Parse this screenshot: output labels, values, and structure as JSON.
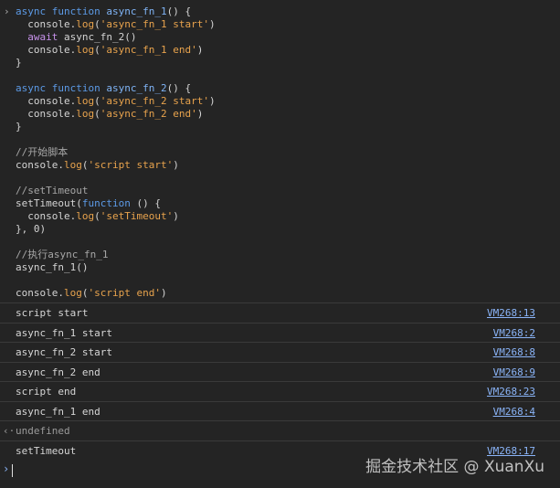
{
  "code": {
    "prompt_glyph": "›",
    "lines": [
      [
        {
          "t": "async ",
          "c": "kw-blue"
        },
        {
          "t": "function ",
          "c": "kw-blue"
        },
        {
          "t": "async_fn_1",
          "c": "fn-name"
        },
        {
          "t": "() {",
          "c": "plain"
        }
      ],
      [
        {
          "t": "  console.",
          "c": "plain"
        },
        {
          "t": "log",
          "c": "method"
        },
        {
          "t": "(",
          "c": "plain"
        },
        {
          "t": "'async_fn_1 start'",
          "c": "str"
        },
        {
          "t": ")",
          "c": "plain"
        }
      ],
      [
        {
          "t": "  await ",
          "c": "kw"
        },
        {
          "t": "async_fn_2()",
          "c": "plain"
        }
      ],
      [
        {
          "t": "  console.",
          "c": "plain"
        },
        {
          "t": "log",
          "c": "method"
        },
        {
          "t": "(",
          "c": "plain"
        },
        {
          "t": "'async_fn_1 end'",
          "c": "str"
        },
        {
          "t": ")",
          "c": "plain"
        }
      ],
      [
        {
          "t": "}",
          "c": "plain"
        }
      ],
      [],
      [
        {
          "t": "async ",
          "c": "kw-blue"
        },
        {
          "t": "function ",
          "c": "kw-blue"
        },
        {
          "t": "async_fn_2",
          "c": "fn-name"
        },
        {
          "t": "() {",
          "c": "plain"
        }
      ],
      [
        {
          "t": "  console.",
          "c": "plain"
        },
        {
          "t": "log",
          "c": "method"
        },
        {
          "t": "(",
          "c": "plain"
        },
        {
          "t": "'async_fn_2 start'",
          "c": "str"
        },
        {
          "t": ")",
          "c": "plain"
        }
      ],
      [
        {
          "t": "  console.",
          "c": "plain"
        },
        {
          "t": "log",
          "c": "method"
        },
        {
          "t": "(",
          "c": "plain"
        },
        {
          "t": "'async_fn_2 end'",
          "c": "str"
        },
        {
          "t": ")",
          "c": "plain"
        }
      ],
      [
        {
          "t": "}",
          "c": "plain"
        }
      ],
      [],
      [
        {
          "t": "//开始脚本",
          "c": "cmt"
        }
      ],
      [
        {
          "t": "console.",
          "c": "plain"
        },
        {
          "t": "log",
          "c": "method"
        },
        {
          "t": "(",
          "c": "plain"
        },
        {
          "t": "'script start'",
          "c": "str"
        },
        {
          "t": ")",
          "c": "plain"
        }
      ],
      [],
      [
        {
          "t": "//setTimeout",
          "c": "cmt"
        }
      ],
      [
        {
          "t": "setTimeout(",
          "c": "plain"
        },
        {
          "t": "function ",
          "c": "kw-blue"
        },
        {
          "t": "() {",
          "c": "plain"
        }
      ],
      [
        {
          "t": "  console.",
          "c": "plain"
        },
        {
          "t": "log",
          "c": "method"
        },
        {
          "t": "(",
          "c": "plain"
        },
        {
          "t": "'setTimeout'",
          "c": "str"
        },
        {
          "t": ")",
          "c": "plain"
        }
      ],
      [
        {
          "t": "}, 0)",
          "c": "plain"
        }
      ],
      [],
      [
        {
          "t": "//执行async_fn_1",
          "c": "cmt"
        }
      ],
      [
        {
          "t": "async_fn_1()",
          "c": "plain"
        }
      ],
      [],
      [
        {
          "t": "console.",
          "c": "plain"
        },
        {
          "t": "log",
          "c": "method"
        },
        {
          "t": "(",
          "c": "plain"
        },
        {
          "t": "'script end'",
          "c": "str"
        },
        {
          "t": ")",
          "c": "plain"
        }
      ]
    ]
  },
  "logs": [
    {
      "text": "script start",
      "source": "VM268:13"
    },
    {
      "text": "async_fn_1 start",
      "source": "VM268:2"
    },
    {
      "text": "async_fn_2 start",
      "source": "VM268:8"
    },
    {
      "text": "async_fn_2 end",
      "source": "VM268:9"
    },
    {
      "text": "script end",
      "source": "VM268:23"
    },
    {
      "text": "async_fn_1 end",
      "source": "VM268:4"
    }
  ],
  "return_value": {
    "glyph": "‹·",
    "text": "undefined"
  },
  "after_log": {
    "text": "setTimeout",
    "source": "VM268:17"
  },
  "input": {
    "prompt_glyph": "›"
  },
  "watermark": "掘金技术社区 @ XuanXu",
  "colors": {
    "background": "#242424",
    "link": "#8ab4f8",
    "string": "#e8a34d",
    "keyword": "#5c9ae6",
    "comment": "#a6a6a6"
  }
}
